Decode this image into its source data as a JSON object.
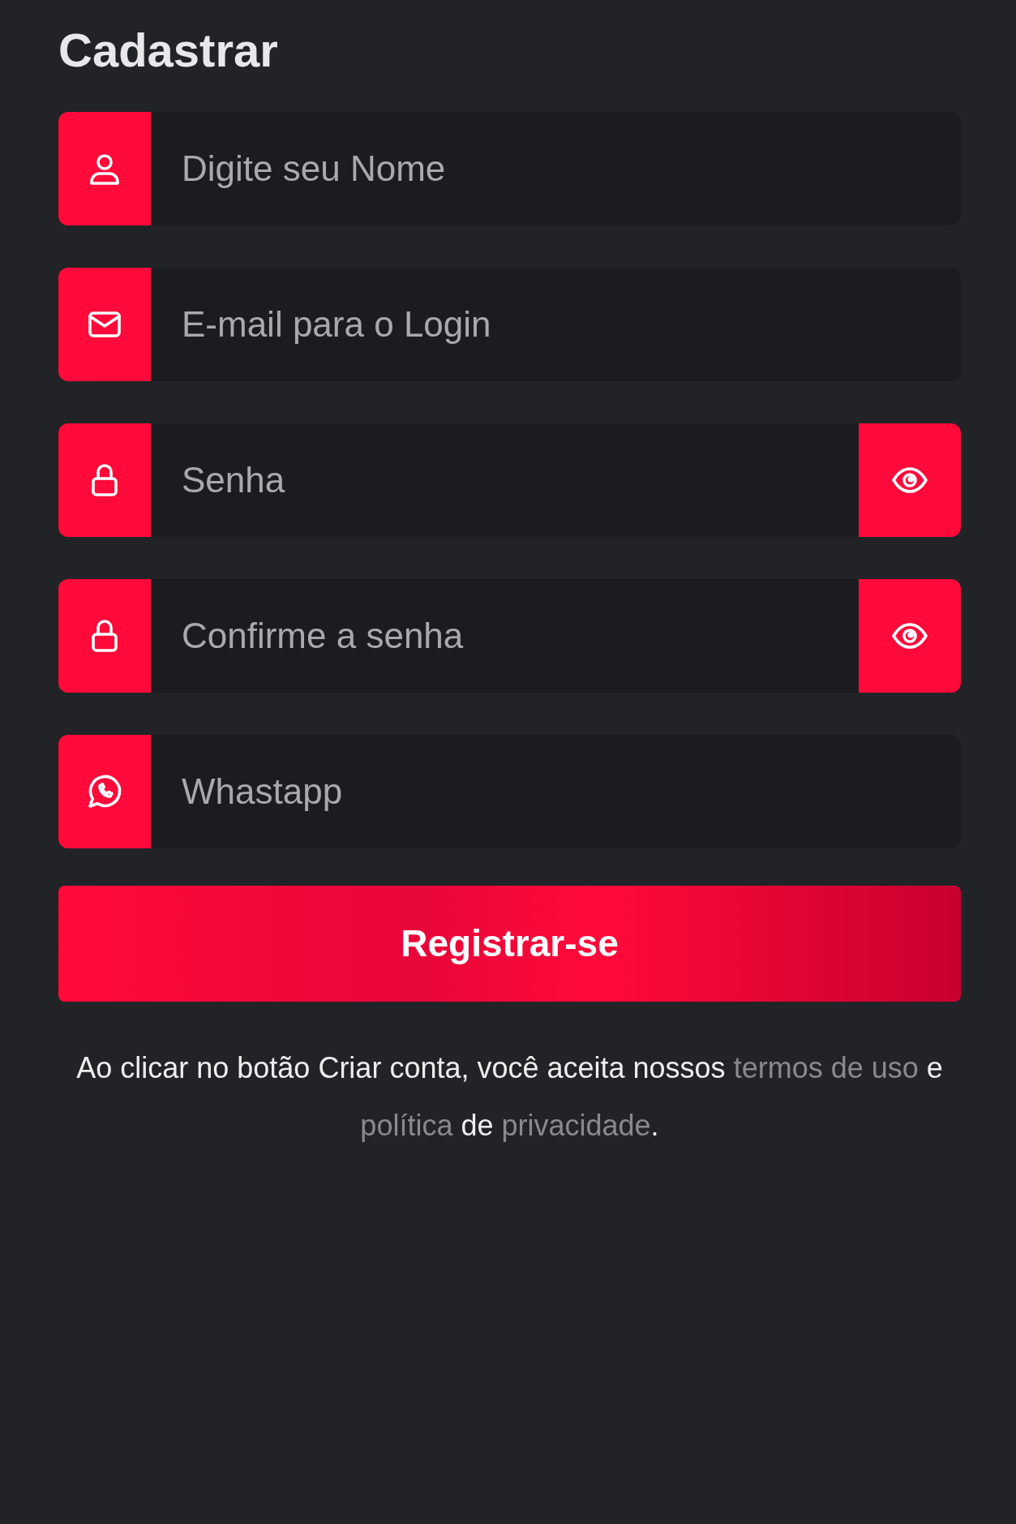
{
  "title": "Cadastrar",
  "fields": [
    {
      "kind": "name",
      "placeholder": "Digite seu Nome"
    },
    {
      "kind": "email",
      "placeholder": "E-mail para o Login"
    },
    {
      "kind": "password",
      "placeholder": "Senha"
    },
    {
      "kind": "password",
      "placeholder": "Confirme a senha"
    },
    {
      "kind": "phone",
      "placeholder": "Whastapp"
    }
  ],
  "submit_button": "Registrar-se",
  "terms": [
    {
      "kind": "text",
      "text": "Ao clicar no botão Criar conta, você aceita nossos "
    },
    {
      "kind": "link",
      "text": "termos de uso"
    },
    {
      "kind": "text",
      "text": " e "
    },
    {
      "kind": "link",
      "text": "política"
    },
    {
      "kind": "text",
      "text": " de "
    },
    {
      "kind": "link",
      "text": "privacidade"
    },
    {
      "kind": "text",
      "text": "."
    }
  ]
}
